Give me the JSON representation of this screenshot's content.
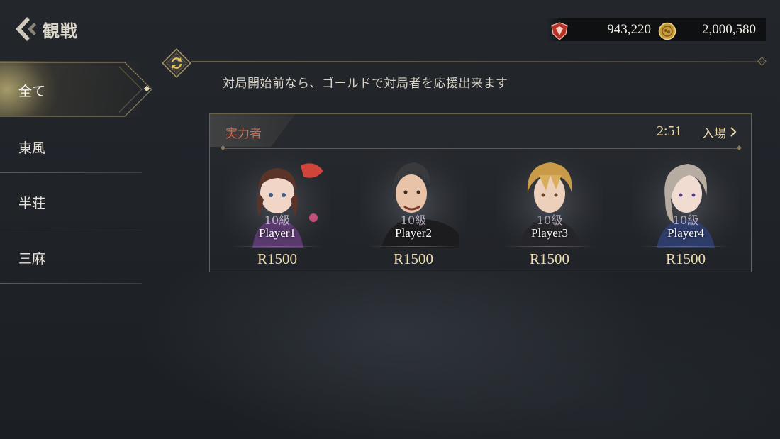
{
  "header": {
    "title": "観戦"
  },
  "currency": {
    "gems": "943,220",
    "gold": "2,000,580"
  },
  "hint": "対局開始前なら、ゴールドで対局者を応援出来ます",
  "sidebar": {
    "tabs": [
      {
        "label": "全て",
        "active": true
      },
      {
        "label": "東風",
        "active": false
      },
      {
        "label": "半荘",
        "active": false
      },
      {
        "label": "三麻",
        "active": false
      }
    ]
  },
  "match": {
    "rank_label": "実力者",
    "timer": "2:51",
    "enter_label": "入場",
    "players": [
      {
        "level": "10級",
        "name": "Player1",
        "rating": "R1500"
      },
      {
        "level": "10級",
        "name": "Player2",
        "rating": "R1500"
      },
      {
        "level": "10級",
        "name": "Player3",
        "rating": "R1500"
      },
      {
        "level": "10級",
        "name": "Player4",
        "rating": "R1500"
      }
    ]
  },
  "colors": {
    "accent_gold": "#ead8a8",
    "rank_red": "#c0705a",
    "frame": "#6b6048"
  }
}
